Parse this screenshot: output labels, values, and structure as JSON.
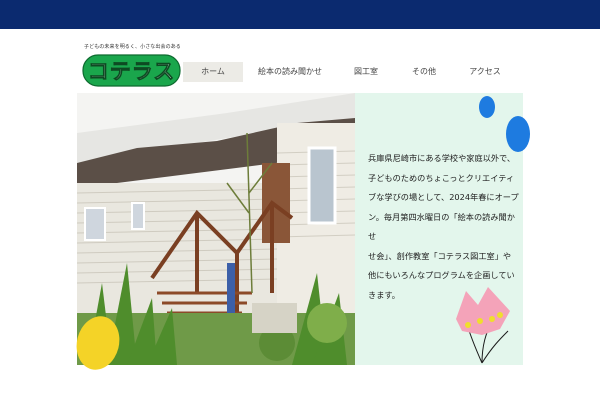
{
  "header": {
    "bar_color": "#0b2a6f",
    "tagline": "子どもの未来を明るく、小さな出会のある",
    "logo_text": "コテラス",
    "logo_color": "#1aa64c"
  },
  "nav": {
    "items": [
      {
        "label": "ホーム",
        "active": true
      },
      {
        "label": "絵本の読み聞かせ",
        "active": false
      },
      {
        "label": "図工室",
        "active": false
      },
      {
        "label": "その他",
        "active": false
      },
      {
        "label": "アクセス",
        "active": false
      }
    ]
  },
  "main": {
    "photo_alt": "house-exterior-photo",
    "panel_color": "#e3f6ec",
    "body_lines": [
      "兵庫県尼崎市にある学校や家庭以外で、",
      "子どものためのちょこっとクリエイティ",
      "ブな学びの場として、2024年春にオープ",
      "ン。毎月第四水曜日の「絵本の読み聞かせ",
      "せ会」、創作教室「コテラス図工室」や",
      "他にもいろんなプログラムを企画してい",
      "きます。"
    ]
  }
}
